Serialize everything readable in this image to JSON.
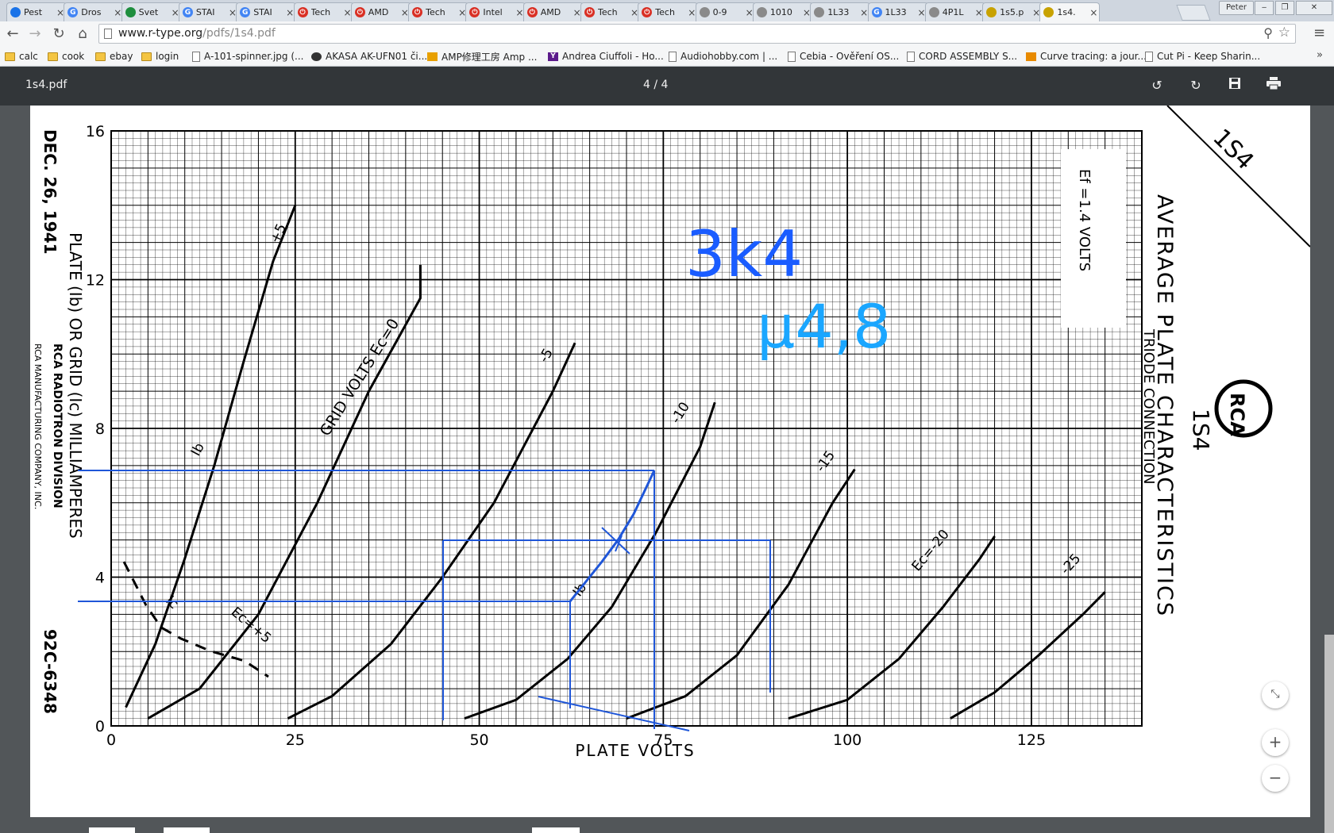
{
  "tabs": [
    {
      "label": "Pest",
      "fav": "chrome",
      "color": "#1a73e8"
    },
    {
      "label": "Dros",
      "fav": "google",
      "color": "#4285f4"
    },
    {
      "label": "Svet",
      "fav": "sheet",
      "color": "#1e8e3e"
    },
    {
      "label": "STAI",
      "fav": "google",
      "color": "#4285f4"
    },
    {
      "label": "STAI",
      "fav": "google",
      "color": "#4285f4"
    },
    {
      "label": "Tech",
      "fav": "power",
      "color": "#d93025"
    },
    {
      "label": "AMD",
      "fav": "power",
      "color": "#d93025"
    },
    {
      "label": "Tech",
      "fav": "power",
      "color": "#d93025"
    },
    {
      "label": "Intel",
      "fav": "power",
      "color": "#d93025"
    },
    {
      "label": "AMD",
      "fav": "power",
      "color": "#d93025"
    },
    {
      "label": "Tech",
      "fav": "power",
      "color": "#d93025"
    },
    {
      "label": "Tech",
      "fav": "power",
      "color": "#d93025"
    },
    {
      "label": "0-9",
      "fav": "gear",
      "color": "#8a8a8a"
    },
    {
      "label": "1010",
      "fav": "gear",
      "color": "#8a8a8a"
    },
    {
      "label": "1L33",
      "fav": "gear",
      "color": "#8a8a8a"
    },
    {
      "label": "1L33",
      "fav": "google",
      "color": "#4285f4"
    },
    {
      "label": "4P1L",
      "fav": "gear",
      "color": "#8a8a8a"
    },
    {
      "label": "1s5.p",
      "fav": "owl",
      "color": "#c8a200"
    },
    {
      "label": "1s4.",
      "fav": "owl",
      "color": "#c8a200",
      "active": true
    }
  ],
  "profile_label": "Peter",
  "url": {
    "host": "www.r-type.org",
    "path": "/pdfs/1s4.pdf"
  },
  "bookmarks": [
    {
      "label": "calc",
      "icon": "folder"
    },
    {
      "label": "cook",
      "icon": "folder"
    },
    {
      "label": "ebay",
      "icon": "folder"
    },
    {
      "label": "login",
      "icon": "folder"
    },
    {
      "label": "A-101-spinner.jpg (...",
      "icon": "page"
    },
    {
      "label": "AKASA AK-UFN01 či...",
      "icon": "akasa"
    },
    {
      "label": "AMP修理工房 Amp ...",
      "icon": "amp"
    },
    {
      "label": "Andrea Ciuffoli - Ho...",
      "icon": "y"
    },
    {
      "label": "Audiohobby.com | ...",
      "icon": "page"
    },
    {
      "label": "Cebia - Ověření OS...",
      "icon": "page"
    },
    {
      "label": "CORD ASSEMBLY S...",
      "icon": "page"
    },
    {
      "label": "Curve tracing: a jour...",
      "icon": "ebox"
    },
    {
      "label": "Cut Pi - Keep Sharin...",
      "icon": "page"
    }
  ],
  "bookmarks_more": "»",
  "pdf": {
    "title": "1s4.pdf",
    "page_indicator": "4 / 4"
  },
  "sheet": {
    "date": "DEC. 26, 1941",
    "ylabel": "PLATE (Ib) OR GRID (Ic) MILLIAMPERES",
    "company1": "RCA RADIOTRON DIVISION",
    "company2": "RCA MANUFACTURING COMPANY, INC.",
    "code": "92C-6348",
    "title1": "AVERAGE PLATE CHARACTERISTICS",
    "title2": "TRIODE CONNECTION",
    "tube": "1S4",
    "corner": "1S4",
    "ef": "Ef =1.4 VOLTS",
    "logo": "RCA",
    "xlabel": "PLATE VOLTS",
    "grid_label": "GRID VOLTS Ec=0",
    "ann1": "3k4",
    "ann2": "μ4,8",
    "curve_labels": {
      "p5": "+5",
      "m5": "-5",
      "m10": "-10",
      "m15": "-15",
      "m20": "Ec=-20",
      "m25": "-25",
      "ib1": "Ib",
      "ib2": "Ib",
      "ic1": "Ic",
      "ic2": "Ec=+5"
    }
  },
  "chart_data": {
    "type": "line",
    "xlabel": "PLATE VOLTS",
    "ylabel": "PLATE (Ib) OR GRID (Ic) MILLIAMPERES",
    "xlim": [
      0,
      140
    ],
    "ylim": [
      0,
      16
    ],
    "x_ticks": [
      0,
      25,
      50,
      75,
      100,
      125
    ],
    "y_ticks": [
      0,
      4,
      8,
      12,
      16
    ],
    "grid": true,
    "series": [
      {
        "name": "+5",
        "x": [
          2,
          6,
          10,
          14,
          18,
          22,
          25
        ],
        "y": [
          0.5,
          2.2,
          4.5,
          7,
          9.8,
          12.5,
          14
        ]
      },
      {
        "name": "0",
        "x": [
          5,
          12,
          20,
          28,
          35,
          42,
          42
        ],
        "y": [
          0.2,
          1,
          3,
          6,
          9,
          11.5,
          12.4
        ]
      },
      {
        "name": "-5",
        "x": [
          24,
          30,
          38,
          45,
          52,
          60,
          63
        ],
        "y": [
          0.2,
          0.8,
          2.2,
          4,
          6,
          9,
          10.3
        ]
      },
      {
        "name": "-10",
        "x": [
          48,
          55,
          62,
          68,
          74,
          80,
          82
        ],
        "y": [
          0.2,
          0.7,
          1.8,
          3.2,
          5.2,
          7.5,
          8.7
        ]
      },
      {
        "name": "-15",
        "x": [
          70,
          78,
          85,
          92,
          98,
          101
        ],
        "y": [
          0.2,
          0.8,
          1.9,
          3.8,
          6,
          6.9
        ]
      },
      {
        "name": "-20",
        "x": [
          92,
          100,
          107,
          113,
          118,
          120
        ],
        "y": [
          0.2,
          0.7,
          1.8,
          3.2,
          4.5,
          5.1
        ]
      },
      {
        "name": "-25",
        "x": [
          114,
          120,
          126,
          132,
          135
        ],
        "y": [
          0.2,
          0.9,
          1.9,
          3,
          3.6
        ]
      }
    ]
  }
}
